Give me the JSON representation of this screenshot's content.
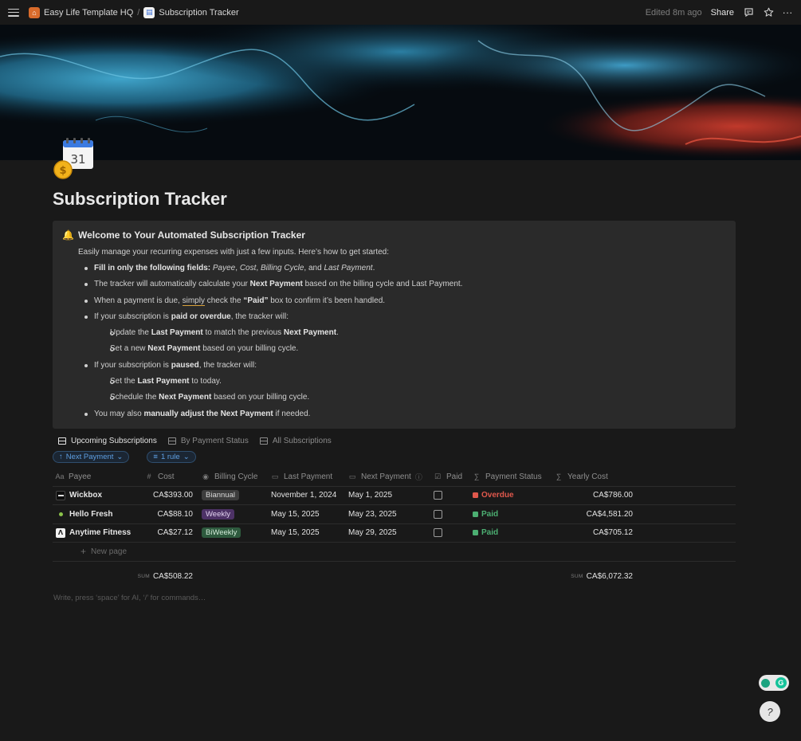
{
  "topbar": {
    "breadcrumbs": [
      {
        "label": "Easy Life Template HQ",
        "icon": "house-icon"
      },
      {
        "label": "Subscription Tracker",
        "icon": "calendar-icon"
      }
    ],
    "separator": "/",
    "edited": "Edited 8m ago",
    "share": "Share"
  },
  "page": {
    "title": "Subscription Tracker"
  },
  "callout": {
    "heading": "Welcome to Your Automated Subscription Tracker",
    "intro": "Easily manage your recurring expenses with just a few inputs. Here’s how to get started:",
    "b1_bold": "Fill in only the following fields:",
    "b1_f1": "Payee",
    "b1_f2": "Cost",
    "b1_f3": "Billing Cycle",
    "b1_and": ", and",
    "b1_f4": "Last Payment",
    "b2_pre": "The tracker will automatically calculate your",
    "b2_bold": "Next Payment",
    "b2_post": "based on the billing cycle and Last Payment.",
    "b3_pre": "When a payment is due,",
    "b3_u": "simply",
    "b3_mid": "check the",
    "b3_bold": "“Paid”",
    "b3_post": "box to confirm it’s been handled.",
    "b4_pre": "If your subscription is",
    "b4_bold": "paid or overdue",
    "b4_post": ", the tracker will:",
    "b4a_pre": "Update the",
    "b4a_bold1": "Last Payment",
    "b4a_mid": "to match the previous",
    "b4a_bold2": "Next Payment",
    "b4b_pre": "Set a new",
    "b4b_bold": "Next Payment",
    "b4b_post": "based on your billing cycle.",
    "b5_pre": "If your subscription is",
    "b5_bold": "paused",
    "b5_post": ", the tracker will:",
    "b5a_pre": "Set the",
    "b5a_bold": "Last Payment",
    "b5a_post": "to today.",
    "b5b_pre": "Schedule the",
    "b5b_bold": "Next Payment",
    "b5b_post": "based on your billing cycle.",
    "b6_pre": "You may also",
    "b6_bold": "manually adjust the Next Payment",
    "b6_post": "if needed."
  },
  "views": {
    "tabs": [
      "Upcoming Subscriptions",
      "By Payment Status",
      "All Subscriptions"
    ],
    "sort_label": "Next Payment",
    "filter_label": "1 rule"
  },
  "table": {
    "headers": {
      "payee": "Payee",
      "cost": "Cost",
      "cycle": "Billing Cycle",
      "last": "Last Payment",
      "next": "Next Payment",
      "paid": "Paid",
      "status": "Payment Status",
      "yearly": "Yearly Cost"
    },
    "rows": [
      {
        "payee": "Wickbox",
        "cost": "CA$393.00",
        "cycle": "Biannual",
        "last": "November 1, 2024",
        "next": "May 1, 2025",
        "paid": false,
        "status": "Overdue",
        "yearly": "CA$786.00"
      },
      {
        "payee": "Hello Fresh",
        "cost": "CA$88.10",
        "cycle": "Weekly",
        "last": "May 15, 2025",
        "next": "May 23, 2025",
        "paid": false,
        "status": "Paid",
        "yearly": "CA$4,581.20"
      },
      {
        "payee": "Anytime Fitness",
        "cost": "CA$27.12",
        "cycle": "BiWeekly",
        "last": "May 15, 2025",
        "next": "May 29, 2025",
        "paid": false,
        "status": "Paid",
        "yearly": "CA$705.12"
      }
    ],
    "new_page": "New page",
    "cost_sum_label": "SUM",
    "cost_sum": "CA$508.22",
    "yearly_sum_label": "SUM",
    "yearly_sum": "CA$6,072.32"
  },
  "editor_hint": "Write, press ‘space’ for AI, ‘/’ for commands…",
  "colors": {
    "overdue": "#e0584c",
    "paid": "#4caf72",
    "biannual_bg": "#3d3d3d",
    "weekly_bg": "#4d3266",
    "biweekly_bg": "#2e5a3e",
    "accent": "#5e9fe2"
  }
}
